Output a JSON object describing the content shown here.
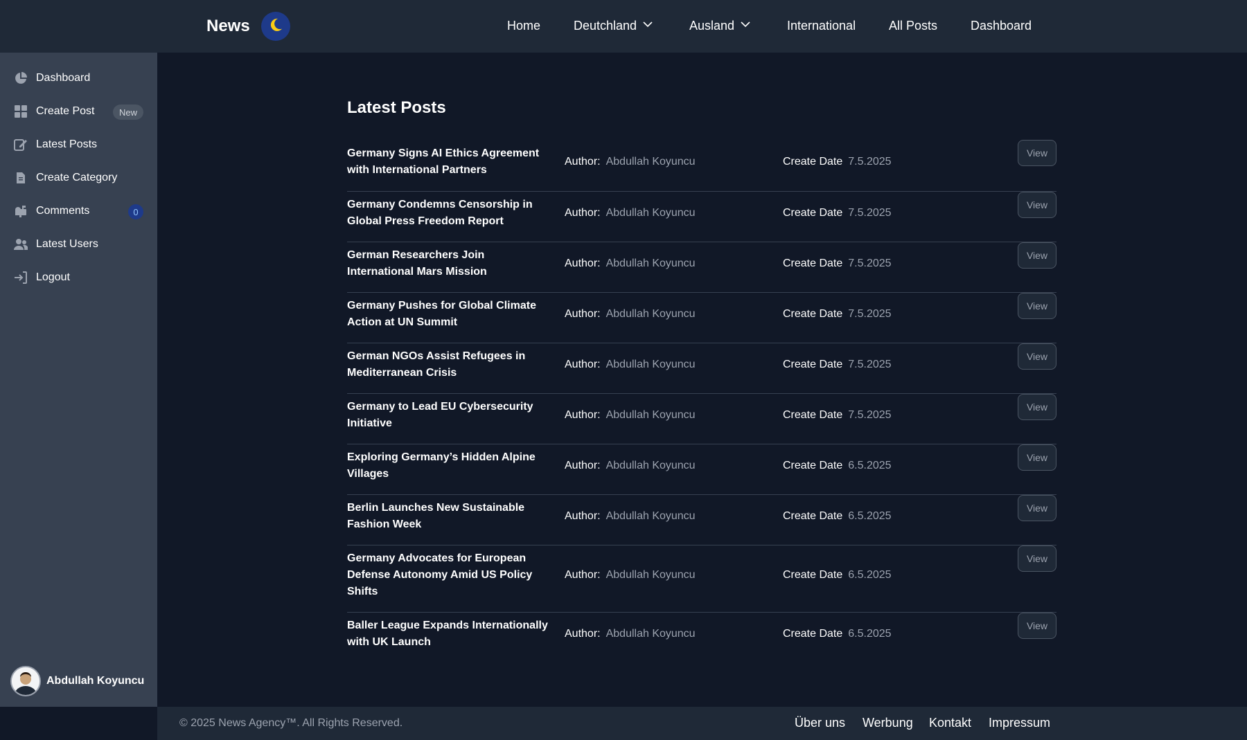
{
  "brand": {
    "name": "News",
    "theme_icon": "moon-icon"
  },
  "nav": {
    "home": "Home",
    "deutschland": "Deutchland",
    "ausland": "Ausland",
    "international": "International",
    "all_posts": "All Posts",
    "dashboard": "Dashboard"
  },
  "sidebar": {
    "items": [
      {
        "label": "Dashboard",
        "icon": "pie-chart-icon"
      },
      {
        "label": "Create Post",
        "icon": "grid-icon",
        "badge": "New"
      },
      {
        "label": "Latest Posts",
        "icon": "edit-icon"
      },
      {
        "label": "Create Category",
        "icon": "document-icon"
      },
      {
        "label": "Comments",
        "icon": "mailbox-icon",
        "badge": "0"
      },
      {
        "label": "Latest Users",
        "icon": "users-icon"
      },
      {
        "label": "Logout",
        "icon": "logout-icon"
      }
    ],
    "user": {
      "name": "Abdullah Koyuncu"
    }
  },
  "main": {
    "title": "Latest Posts",
    "author_label": "Author:",
    "date_label": "Create Date",
    "view_label": "View",
    "posts": [
      {
        "title": "Germany Signs AI Ethics Agreement with International Partners",
        "author": "Abdullah Koyuncu",
        "date": "7.5.2025"
      },
      {
        "title": "Germany Condemns Censorship in Global Press Freedom Report",
        "author": "Abdullah Koyuncu",
        "date": "7.5.2025"
      },
      {
        "title": "German Researchers Join International Mars Mission",
        "author": "Abdullah Koyuncu",
        "date": "7.5.2025"
      },
      {
        "title": "Germany Pushes for Global Climate Action at UN Summit",
        "author": "Abdullah Koyuncu",
        "date": "7.5.2025"
      },
      {
        "title": "German NGOs Assist Refugees in Mediterranean Crisis",
        "author": "Abdullah Koyuncu",
        "date": "7.5.2025"
      },
      {
        "title": "Germany to Lead EU Cybersecurity Initiative",
        "author": "Abdullah Koyuncu",
        "date": "7.5.2025"
      },
      {
        "title": "Exploring Germany’s Hidden Alpine Villages",
        "author": "Abdullah Koyuncu",
        "date": "6.5.2025"
      },
      {
        "title": "Berlin Launches New Sustainable Fashion Week",
        "author": "Abdullah Koyuncu",
        "date": "6.5.2025"
      },
      {
        "title": "Germany Advocates for European Defense Autonomy Amid US Policy Shifts",
        "author": "Abdullah Koyuncu",
        "date": "6.5.2025"
      },
      {
        "title": "Baller League Expands Internationally with UK Launch",
        "author": "Abdullah Koyuncu",
        "date": "6.5.2025"
      }
    ]
  },
  "footer": {
    "copyright": "© 2025 News Agency™. All Rights Reserved.",
    "links": [
      "Über uns",
      "Werbung",
      "Kontakt",
      "Impressum"
    ]
  },
  "colors": {
    "page_bg": "#111827",
    "header_bg": "#1f2937",
    "sidebar_bg": "#374151",
    "muted_text": "#9ca3af",
    "toggle_bg": "#1e3a8a"
  }
}
